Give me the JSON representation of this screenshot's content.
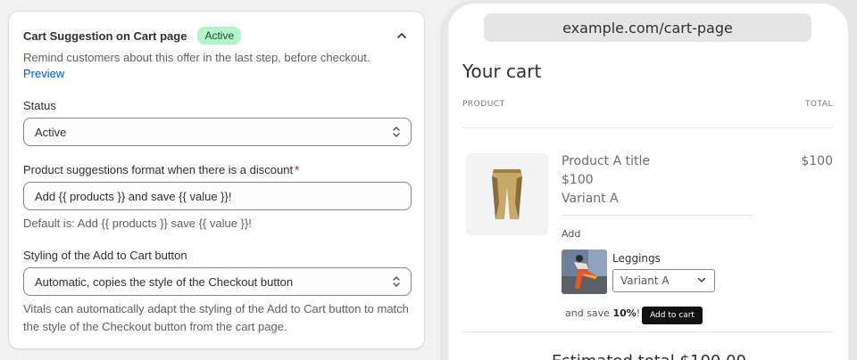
{
  "settings": {
    "title": "Cart Suggestion on Cart page",
    "badge": "Active",
    "description": "Remind customers about this offer in the last step, before checkout.",
    "preview_link": "Preview",
    "status": {
      "label": "Status",
      "value": "Active"
    },
    "format": {
      "label": "Product suggestions format when there is a discount",
      "required_mark": "*",
      "value": "Add {{ products }} and save {{ value }}!",
      "help": "Default is: Add {{ products }} save {{ value }}!"
    },
    "styling": {
      "label": "Styling of the Add to Cart button",
      "value": "Automatic, copies the style of the Checkout button",
      "help": "Vitals can automatically adapt the styling of the Add to Cart button to match the style of the Checkout button from the cart page."
    }
  },
  "preview": {
    "url": "example.com/cart-page",
    "cart_title": "Your cart",
    "col_product": "PRODUCT",
    "col_total": "TOTAL",
    "item": {
      "title": "Product A title",
      "price": "$100",
      "variant": "Variant A",
      "line_total": "$100"
    },
    "suggestion": {
      "add_label": "Add",
      "name": "Leggings",
      "variant": "Variant A",
      "save_prefix": "and save ",
      "save_value": "10%",
      "save_suffix": "!",
      "button": "Add to cart"
    },
    "estimated_total": "Estimated total $100.00"
  },
  "colors": {
    "badge_bg": "#b4f4c8",
    "link": "#005bd3",
    "required": "#c70a24"
  }
}
